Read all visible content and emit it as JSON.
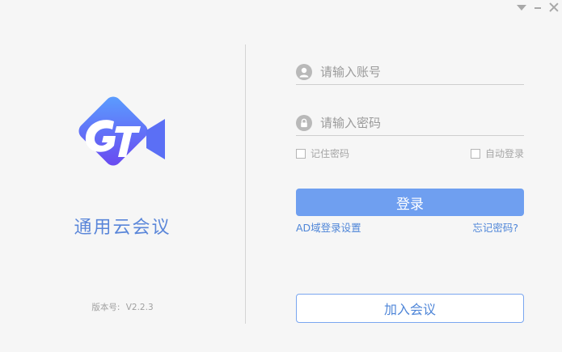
{
  "window": {
    "controls": [
      {
        "name": "dropdown-icon"
      },
      {
        "name": "minimize-icon"
      },
      {
        "name": "close-icon"
      }
    ]
  },
  "brand": {
    "app_name": "通用云会议",
    "logo_icon": "gt-video-camera-logo",
    "logo_color": "#5b6ff5"
  },
  "version": {
    "label": "版本号:",
    "value": "V2.2.3"
  },
  "login": {
    "account_placeholder": "请输入账号",
    "password_placeholder": "请输入密码",
    "remember_password": "记住密码",
    "auto_login": "自动登录",
    "login_button": "登录",
    "ad_login_settings": "AD域登录设置",
    "forgot_password": "忘记密码?",
    "join_meeting": "加入会议"
  },
  "colors": {
    "accent": "#6f9ff0",
    "link": "#4f86d8",
    "background": "#f6f6f6"
  }
}
